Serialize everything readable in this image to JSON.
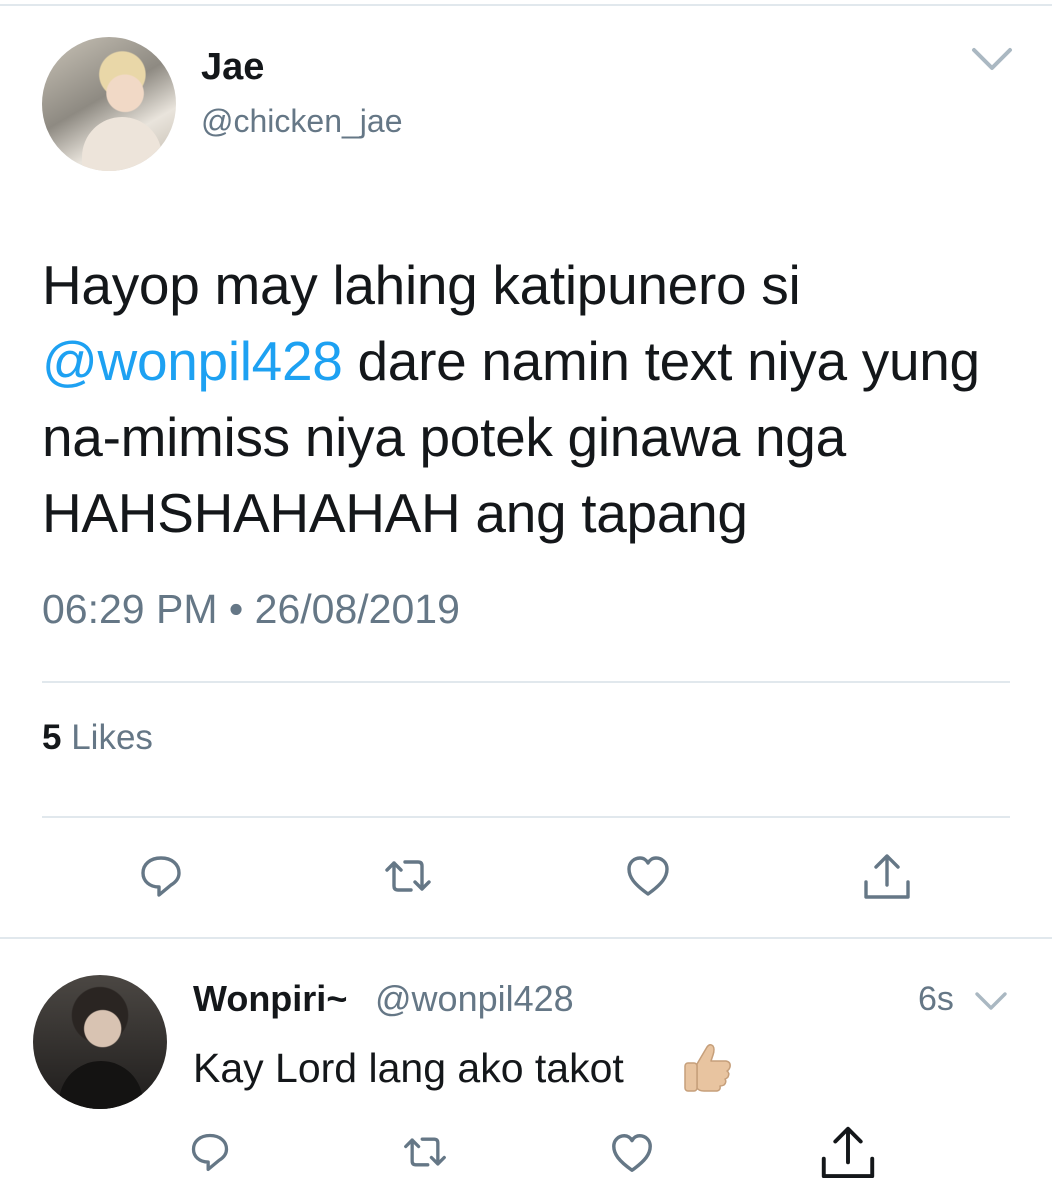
{
  "tweet": {
    "display_name": "Jae",
    "handle": "@chicken_jae",
    "text_before_mention": "Hayop may lahing katipunero si ",
    "mention": "@wonpil428",
    "text_after_mention": " dare namin text niya yung na-mimiss niya potek ginawa nga HAHSHAHAHAH ang tapang",
    "time": "06:29 PM",
    "date_separator": "•",
    "date": "26/08/2019",
    "likes_count": "5",
    "likes_label": "Likes"
  },
  "reply": {
    "display_name": "Wonpiri~",
    "handle": "@wonpil428",
    "time_ago": "6s",
    "text": "Kay Lord lang ako takot"
  },
  "icons": {
    "reply": "reply-icon",
    "retweet": "retweet-icon",
    "like": "heart-icon",
    "share": "share-icon",
    "more": "chevron-down-icon",
    "emoji": "thumbs-up-emoji"
  },
  "colors": {
    "text": "#14171a",
    "secondary": "#657786",
    "link": "#1da1f2",
    "divider": "#e1e8ed"
  }
}
